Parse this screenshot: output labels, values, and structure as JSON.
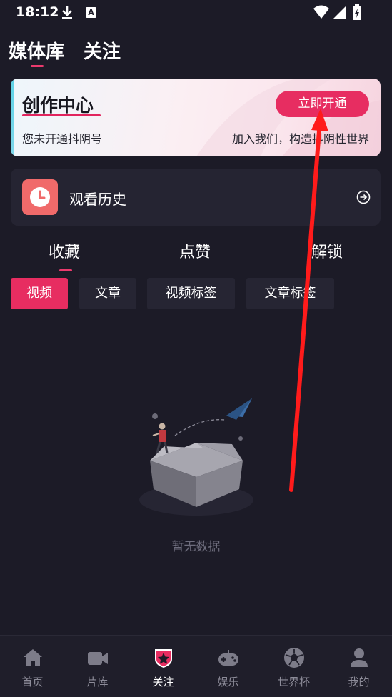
{
  "status_bar": {
    "time": "18:12",
    "input_badge": "A"
  },
  "top_tabs": [
    "媒体库",
    "关注"
  ],
  "creator": {
    "title": "创作中心",
    "button": "立即开通",
    "desc_left": "您未开通抖阴号",
    "desc_right": "加入我们，构造抖阴性世界"
  },
  "history": {
    "label": "观看历史"
  },
  "sub_tabs": [
    "收藏",
    "点赞",
    "解锁"
  ],
  "chips": [
    "视频",
    "文章",
    "视频标签",
    "文章标签"
  ],
  "empty": {
    "text": "暂无数据"
  },
  "bottom_nav": [
    "首页",
    "片库",
    "关注",
    "娱乐",
    "世界杯",
    "我的"
  ],
  "colors": {
    "accent": "#e72d61",
    "background": "#1c1b27",
    "card": "#252432"
  }
}
